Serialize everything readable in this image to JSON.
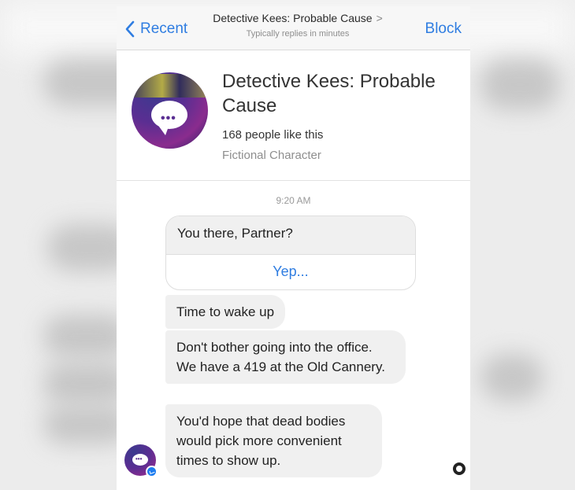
{
  "navbar": {
    "back_label": "Recent",
    "title": "Detective Kees: Probable Cause",
    "title_chevron": ">",
    "subtitle": "Typically replies in minutes",
    "block_label": "Block"
  },
  "profile": {
    "name": "Detective Kees: Probable Cause",
    "likes": "168 people like this",
    "category": "Fictional Character",
    "avatar_dots": "•••"
  },
  "chat": {
    "timestamp": "9:20 AM",
    "card": {
      "question": "You there, Partner?",
      "quick_reply": "Yep..."
    },
    "messages": [
      "Time to wake up",
      "Don't bother going into the office. We have a 419 at the Old Cannery.",
      "You'd hope that dead bodies would pick more convenient times to show up."
    ],
    "avatar_dots": "•••"
  },
  "colors": {
    "accent": "#2f7de1",
    "bubble_bg": "#f0f0f0",
    "messenger_badge": "#1e7df0"
  },
  "icons": {
    "back": "chevron-left-icon",
    "title_chevron": "chevron-right-icon",
    "badge": "messenger-icon",
    "seen": "seen-indicator-icon"
  }
}
